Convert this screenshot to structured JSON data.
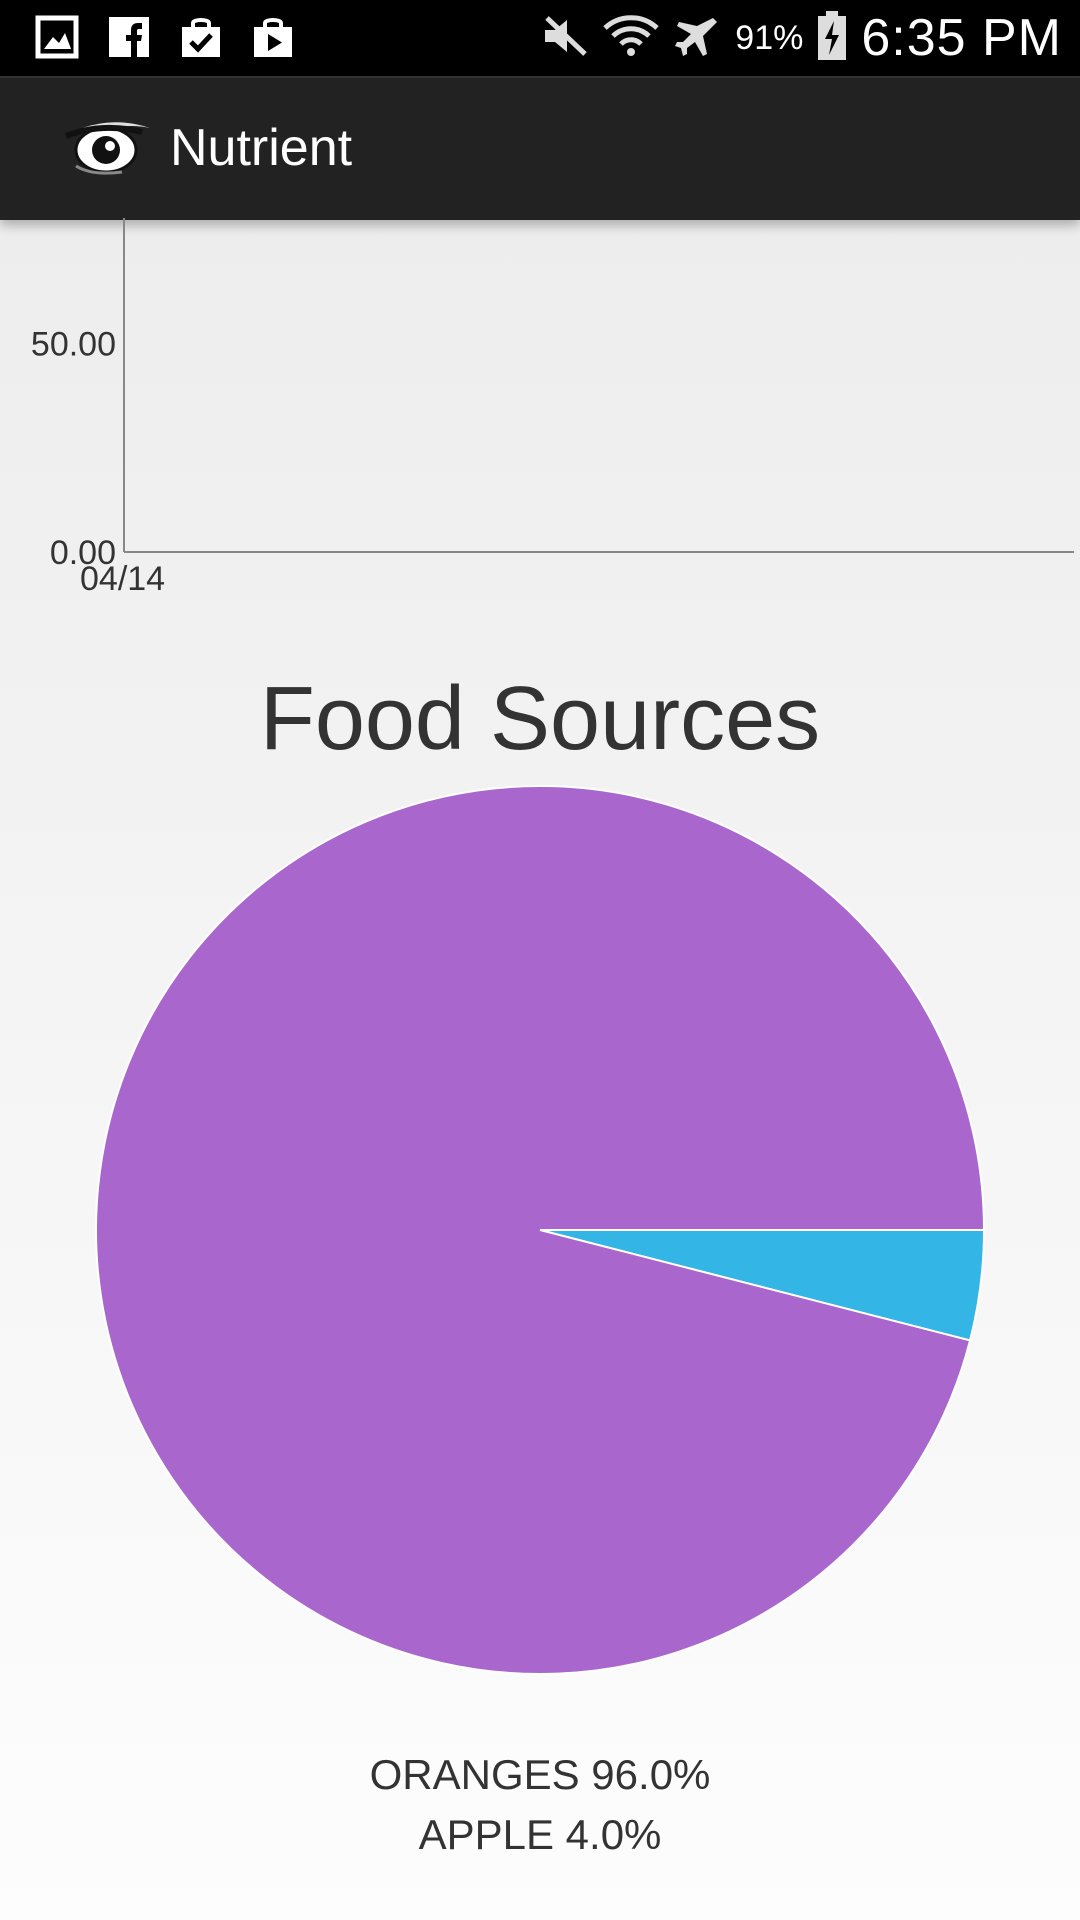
{
  "status_bar": {
    "left_icons": [
      "gallery-icon",
      "facebook-icon",
      "shopping-bag-check-icon",
      "play-store-icon"
    ],
    "right_icons": [
      "mute-icon",
      "wifi-icon",
      "airplane-icon",
      "battery-charging-icon"
    ],
    "battery": "91%",
    "time": "6:35 PM"
  },
  "action_bar": {
    "logo_icon": "eye-logo-icon",
    "title": "Nutrient"
  },
  "line_chart_data": {
    "type": "line",
    "ytick_labels": [
      "50.00",
      "0.00"
    ],
    "yticks": [
      50,
      0
    ],
    "xtick_labels": [
      "04/14"
    ],
    "ylim": [
      0,
      80
    ],
    "series": []
  },
  "chart_data": {
    "type": "pie",
    "title": "Food Sources",
    "slices": [
      {
        "label": "ORANGES",
        "value": 96.0,
        "color": "#a967cd"
      },
      {
        "label": "APPLE",
        "value": 4.0,
        "color": "#33b5e5"
      }
    ],
    "legend": [
      "ORANGES 96.0%",
      "APPLE 4.0%"
    ]
  }
}
